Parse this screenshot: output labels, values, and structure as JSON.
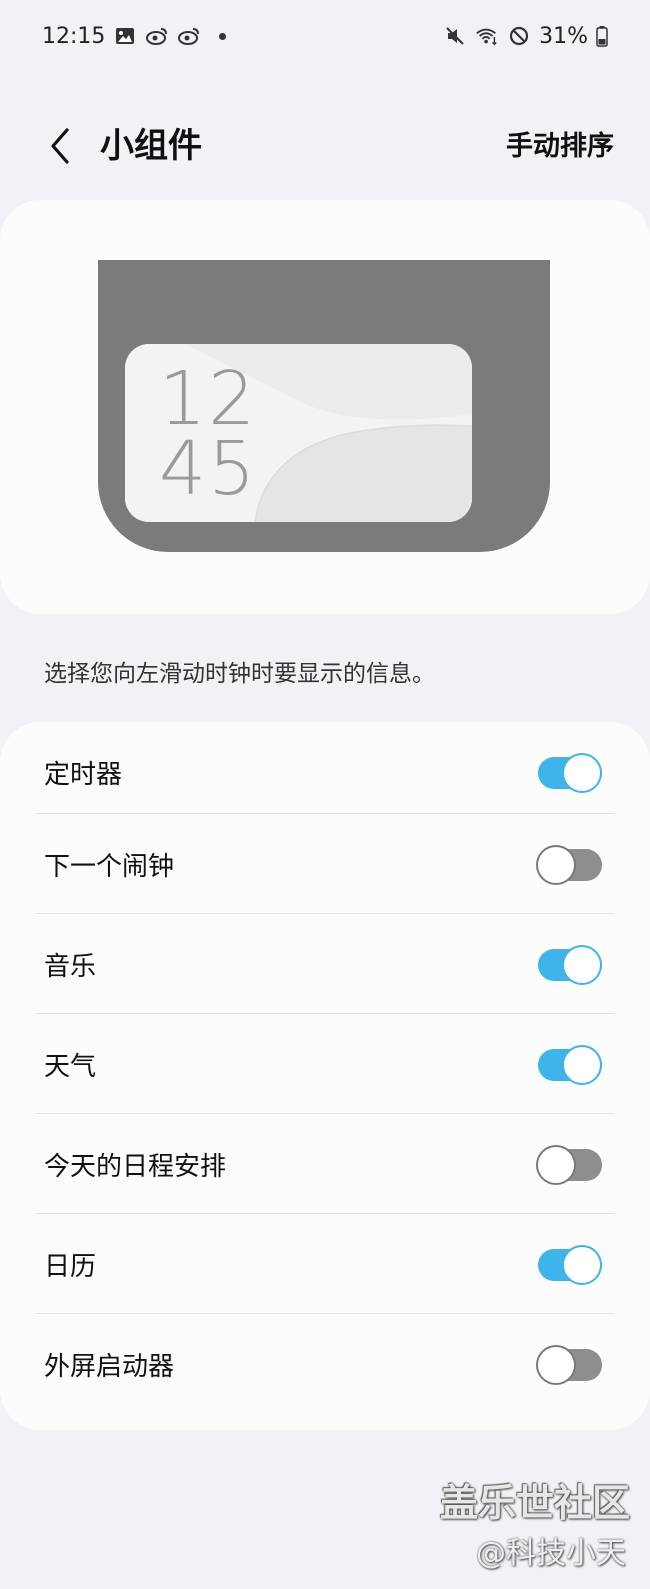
{
  "status_bar": {
    "time": "12:15",
    "battery": "31%",
    "left_icons": [
      "image-icon",
      "weibo-icon",
      "weibo-icon"
    ],
    "right_icons": [
      "mute-icon",
      "wifi-icon",
      "do-not-disturb-icon",
      "battery-icon"
    ]
  },
  "header": {
    "title": "小组件",
    "action": "手动排序",
    "back_icon": "chevron-left-icon"
  },
  "preview": {
    "clock_hour": "12",
    "clock_minute": "45"
  },
  "description": "选择您向左滑动时钟时要显示的信息。",
  "settings": {
    "items": [
      {
        "label": "定时器",
        "on": true
      },
      {
        "label": "下一个闹钟",
        "on": false
      },
      {
        "label": "音乐",
        "on": true
      },
      {
        "label": "天气",
        "on": true
      },
      {
        "label": "今天的日程安排",
        "on": false
      },
      {
        "label": "日历",
        "on": true
      },
      {
        "label": "外屏启动器",
        "on": false
      }
    ]
  },
  "colors": {
    "toggle_on": "#3fb4ea",
    "toggle_off": "#8e8e8e",
    "background": "#f0f2f5",
    "card": "#fcfcfd"
  },
  "watermark": {
    "main": "盖乐世社区",
    "sub": "@科技小天"
  }
}
